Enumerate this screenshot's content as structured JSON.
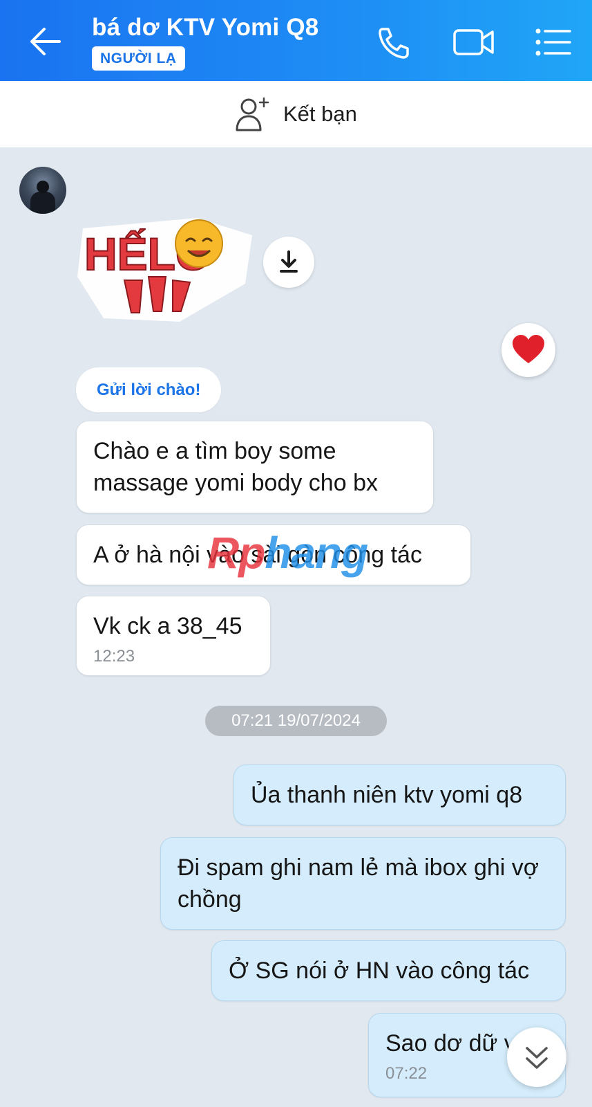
{
  "header": {
    "title": "bá dơ KTV Yomi Q8",
    "badge": "NGƯỜI LẠ",
    "icons": [
      "back-arrow-icon",
      "phone-icon",
      "video-call-icon",
      "menu-list-icon"
    ]
  },
  "friend_bar": {
    "label": "Kết bạn",
    "icon": "add-friend-icon"
  },
  "sticker": {
    "text": "HẾLO"
  },
  "greeting_chip": "Gửi lời chào!",
  "messages_in": [
    {
      "text": "Chào e a tìm boy some massage yomi body cho bx"
    },
    {
      "text": "A ở hà nội vào sài gòn công tác"
    },
    {
      "text": "Vk ck a 38_45",
      "time": "12:23"
    }
  ],
  "date_separator": "07:21 19/07/2024",
  "messages_out": [
    {
      "text": "Ủa thanh niên ktv yomi q8"
    },
    {
      "text": "Đi spam ghi nam lẻ mà ibox ghi vợ chồng"
    },
    {
      "text": "Ở SG nói ở HN vào công tác"
    },
    {
      "text": "Sao dơ dữ v",
      "time": "07:22"
    }
  ],
  "watermark": {
    "part1": "Rp",
    "part2": "hang"
  },
  "colors": {
    "header_gradient_start": "#1a73f0",
    "header_gradient_end": "#20a6f7",
    "chat_bg": "#e1e8f0",
    "outgoing_bubble": "#d4ecfb",
    "accent": "#1b74e8"
  }
}
